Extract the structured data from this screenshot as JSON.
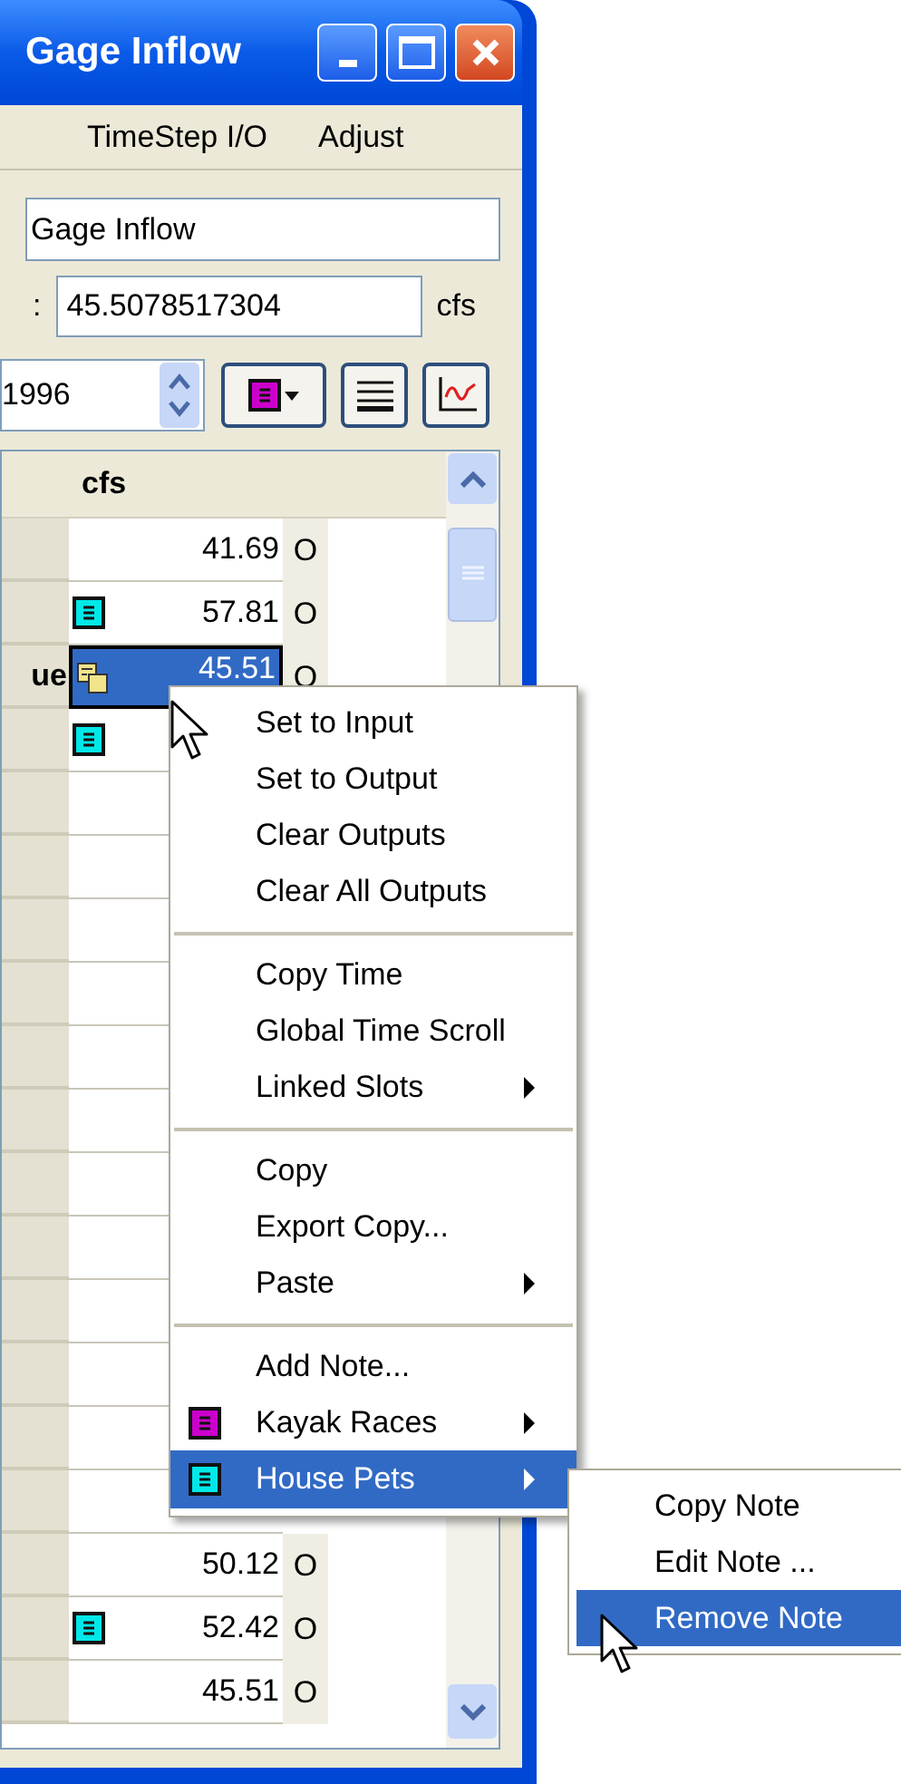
{
  "window": {
    "title": "Gage Inflow"
  },
  "menu_bar": [
    "TimeStep I/O",
    "Adjust"
  ],
  "name_field": {
    "value": "Gage Inflow"
  },
  "value_row": {
    "label": ":",
    "value": "45.5078517304",
    "unit": "cfs"
  },
  "date_field": {
    "value": "1996"
  },
  "table": {
    "columns": [
      "cfs"
    ],
    "rows": [
      {
        "value": "41.69",
        "flag": "O",
        "selected": false
      },
      {
        "note": {
          "kind": "single",
          "color": "#00e8e8"
        },
        "value": "57.81",
        "flag": "O",
        "selected": false
      },
      {
        "label": "ue",
        "note": {
          "kind": "multiple",
          "color": "#f2e48a"
        },
        "value": "45.51",
        "flag": "O",
        "selected": true
      },
      {
        "note": {
          "kind": "single",
          "color": "#00e8e8"
        },
        "selected": false
      },
      {
        "selected": false
      },
      {
        "selected": false
      },
      {
        "selected": false
      },
      {
        "selected": false
      },
      {
        "selected": false
      },
      {
        "selected": false
      },
      {
        "selected": false
      },
      {
        "selected": false
      },
      {
        "selected": false
      },
      {
        "selected": false
      },
      {
        "selected": false
      },
      {
        "selected": false
      },
      {
        "value": "50.12",
        "flag": "O",
        "selected": false
      },
      {
        "note": {
          "kind": "single",
          "color": "#00e8e8"
        },
        "value": "52.42",
        "flag": "O",
        "selected": false
      },
      {
        "value": "45.51",
        "flag": "O",
        "selected": false
      }
    ]
  },
  "context_menu": {
    "items": [
      {
        "kind": "item",
        "label": "Set to Input",
        "submenu": false,
        "selected": false
      },
      {
        "kind": "item",
        "label": "Set to Output",
        "submenu": false,
        "selected": false
      },
      {
        "kind": "item",
        "label": "Clear Outputs",
        "submenu": false,
        "selected": false
      },
      {
        "kind": "item",
        "label": "Clear All Outputs",
        "submenu": false,
        "selected": false
      },
      {
        "kind": "separator"
      },
      {
        "kind": "item",
        "label": "Copy Time",
        "submenu": false,
        "selected": false
      },
      {
        "kind": "item",
        "label": "Global Time Scroll",
        "submenu": false,
        "selected": false
      },
      {
        "kind": "item",
        "label": "Linked Slots",
        "submenu": true,
        "selected": false
      },
      {
        "kind": "separator"
      },
      {
        "kind": "item",
        "label": "Copy",
        "submenu": false,
        "selected": false
      },
      {
        "kind": "item",
        "label": "Export Copy...",
        "submenu": false,
        "selected": false
      },
      {
        "kind": "item",
        "label": "Paste",
        "submenu": true,
        "selected": false
      },
      {
        "kind": "separator"
      },
      {
        "kind": "item",
        "label": "Add Note...",
        "submenu": false,
        "selected": false
      },
      {
        "kind": "item",
        "label": "Kayak Races",
        "color": "#cc00cc",
        "submenu": true,
        "selected": false
      },
      {
        "kind": "item",
        "label": "House Pets",
        "color": "#00e8e8",
        "submenu": true,
        "selected": true
      }
    ]
  },
  "submenu": {
    "items": [
      {
        "label": "Copy Note",
        "selected": false
      },
      {
        "label": "Edit Note ...",
        "selected": false
      },
      {
        "label": "Remove Note",
        "selected": true
      }
    ]
  }
}
